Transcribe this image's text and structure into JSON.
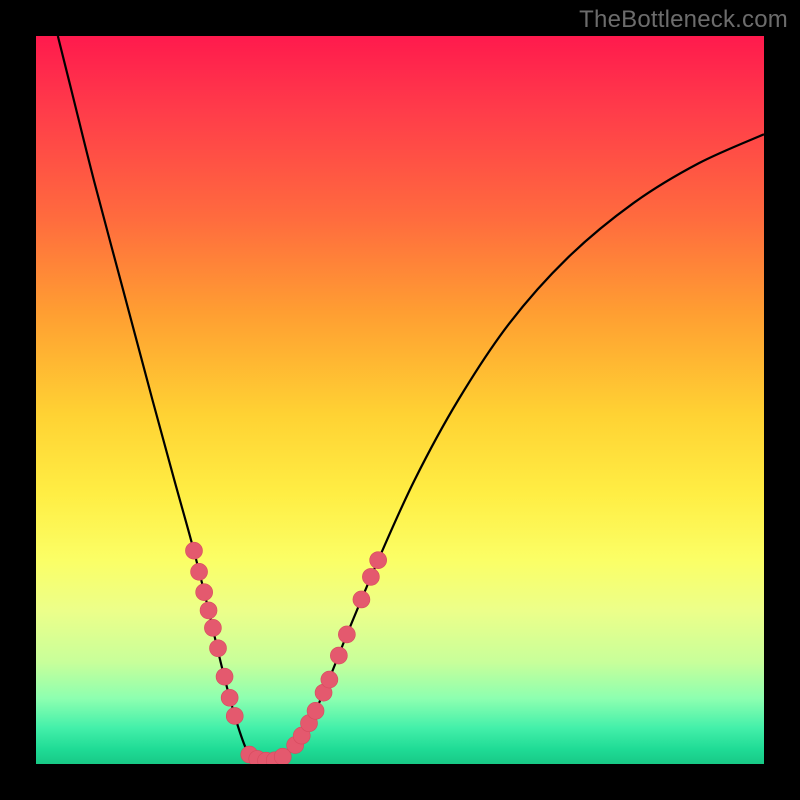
{
  "watermark": "TheBottleneck.com",
  "colors": {
    "marker_fill": "#e4596e",
    "marker_stroke": "#d74a5e",
    "curve_stroke": "#000000"
  },
  "chart_data": {
    "type": "line",
    "title": "",
    "xlabel": "",
    "ylabel": "",
    "xlim": [
      0,
      100
    ],
    "ylim": [
      0,
      100
    ],
    "grid": false,
    "legend": false,
    "curve": [
      {
        "x": 3.0,
        "y": 100.0
      },
      {
        "x": 5.0,
        "y": 92.0
      },
      {
        "x": 8.0,
        "y": 80.0
      },
      {
        "x": 12.0,
        "y": 65.0
      },
      {
        "x": 16.0,
        "y": 50.0
      },
      {
        "x": 19.0,
        "y": 39.0
      },
      {
        "x": 21.5,
        "y": 30.0
      },
      {
        "x": 23.5,
        "y": 22.0
      },
      {
        "x": 25.0,
        "y": 15.5
      },
      {
        "x": 26.5,
        "y": 9.5
      },
      {
        "x": 27.8,
        "y": 5.0
      },
      {
        "x": 29.0,
        "y": 1.8
      },
      {
        "x": 30.2,
        "y": 0.6
      },
      {
        "x": 31.5,
        "y": 0.4
      },
      {
        "x": 33.0,
        "y": 0.5
      },
      {
        "x": 34.5,
        "y": 1.4
      },
      {
        "x": 36.0,
        "y": 3.0
      },
      {
        "x": 38.0,
        "y": 6.5
      },
      {
        "x": 40.0,
        "y": 11.0
      },
      {
        "x": 43.0,
        "y": 18.5
      },
      {
        "x": 47.0,
        "y": 28.0
      },
      {
        "x": 52.0,
        "y": 39.0
      },
      {
        "x": 58.0,
        "y": 50.0
      },
      {
        "x": 65.0,
        "y": 60.5
      },
      {
        "x": 73.0,
        "y": 69.5
      },
      {
        "x": 82.0,
        "y": 77.0
      },
      {
        "x": 91.0,
        "y": 82.5
      },
      {
        "x": 100.0,
        "y": 86.5
      }
    ],
    "markers_left": [
      {
        "x": 21.7,
        "y": 29.3
      },
      {
        "x": 22.4,
        "y": 26.4
      },
      {
        "x": 23.1,
        "y": 23.6
      },
      {
        "x": 23.7,
        "y": 21.1
      },
      {
        "x": 24.3,
        "y": 18.7
      },
      {
        "x": 25.0,
        "y": 15.9
      },
      {
        "x": 25.9,
        "y": 12.0
      },
      {
        "x": 26.6,
        "y": 9.1
      },
      {
        "x": 27.3,
        "y": 6.6
      }
    ],
    "markers_bottom": [
      {
        "x": 29.3,
        "y": 1.3
      },
      {
        "x": 30.4,
        "y": 0.7
      },
      {
        "x": 31.6,
        "y": 0.45
      },
      {
        "x": 32.8,
        "y": 0.5
      },
      {
        "x": 33.9,
        "y": 1.0
      }
    ],
    "markers_right": [
      {
        "x": 35.6,
        "y": 2.6
      },
      {
        "x": 36.5,
        "y": 3.9
      },
      {
        "x": 37.5,
        "y": 5.6
      },
      {
        "x": 38.4,
        "y": 7.3
      },
      {
        "x": 39.5,
        "y": 9.8
      },
      {
        "x": 40.3,
        "y": 11.6
      },
      {
        "x": 41.6,
        "y": 14.9
      },
      {
        "x": 42.7,
        "y": 17.8
      },
      {
        "x": 44.7,
        "y": 22.6
      },
      {
        "x": 46.0,
        "y": 25.7
      },
      {
        "x": 47.0,
        "y": 28.0
      }
    ]
  }
}
